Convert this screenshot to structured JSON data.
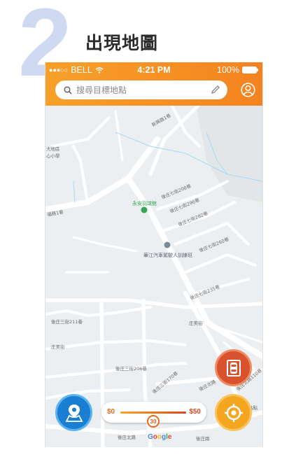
{
  "step": {
    "number": "2",
    "title": "出現地圖"
  },
  "status_bar": {
    "carrier": "BELL",
    "time": "4:21 PM",
    "battery": "100%"
  },
  "search": {
    "placeholder": "搜尋目標地點"
  },
  "map": {
    "labels": [
      "新興路1巷",
      "大地區",
      "心小學",
      "福路1巷",
      "後庄七街208巷",
      "後庄七街296巷",
      "後庄七街282巷",
      "後庄七街260巷",
      "後庄七街235巷",
      "後庄三街211巷",
      "庄美街",
      "庄美街",
      "後庄三街206巷",
      "後庄三街170巷",
      "後庄北路",
      "後庄北路110巷",
      "後庄北路",
      "後庄路",
      "站點"
    ],
    "places": [
      {
        "name": "永安羽球館",
        "color": "#34a853"
      },
      {
        "name": "華江汽車駕駛人訓練班",
        "color": "#7b8a99"
      }
    ],
    "attribution": "Google"
  },
  "price_slider": {
    "min_label": "$0",
    "max_label": "$50",
    "value": "30",
    "fraction": 0.5
  },
  "buttons": {
    "map_button": "map-pin-icon",
    "parking_button": "car-icon",
    "locate_button": "crosshair-icon"
  },
  "colors": {
    "header_start": "#f6a12a",
    "header_end": "#f5821f",
    "map_button": "#1a7fd3",
    "parking_button": "#d8522d",
    "locate_button": "#f4a621"
  }
}
